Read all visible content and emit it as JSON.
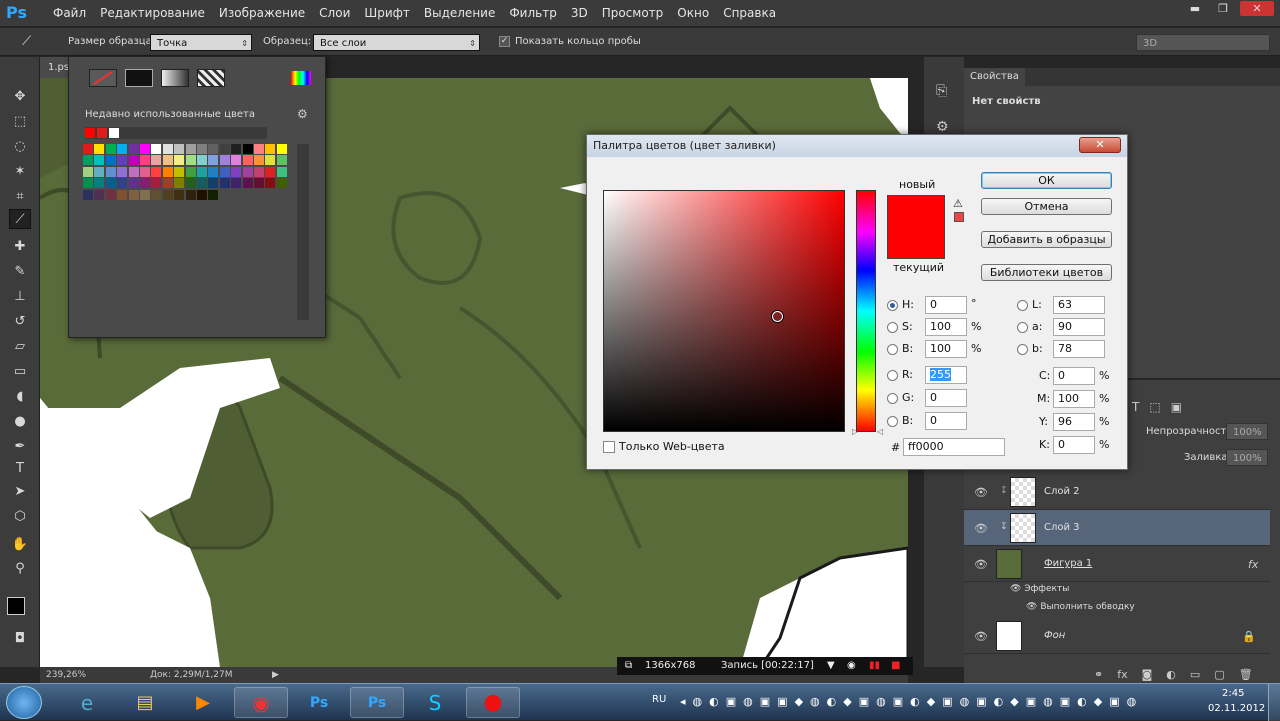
{
  "menubar": {
    "logo": "Ps",
    "items": [
      "Файл",
      "Редактирование",
      "Изображение",
      "Слои",
      "Шрифт",
      "Выделение",
      "Фильтр",
      "3D",
      "Просмотр",
      "Окно",
      "Справка"
    ],
    "minimize": "▬",
    "restore": "❐",
    "close": "✕"
  },
  "options": {
    "sample_size_label": "Размер образца:",
    "sample_size_value": "Точка",
    "sample_label": "Образец:",
    "sample_value": "Все слои",
    "show_ring": "Показать кольцо пробы",
    "workspace": "3D"
  },
  "document": {
    "tab": "1.ps",
    "zoom": "239,26%",
    "doc_info": "Док: 2,29M/1,27M"
  },
  "swatches": {
    "recent_label": "Недавно использованные цвета",
    "recent": [
      "#ff0000",
      "#e31b1b",
      "#ffffff"
    ],
    "colors": [
      "#e31b1b",
      "#ffe000",
      "#00b050",
      "#00b0f0",
      "#7030a0",
      "#ff00ff",
      "#ffffff",
      "#e0e0e0",
      "#c0c0c0",
      "#a0a0a0",
      "#808080",
      "#606060",
      "#404040",
      "#202020",
      "#000000",
      "#ff8080",
      "#ffc000",
      "#ffff00",
      "#00a060",
      "#00c0c0",
      "#0070c0",
      "#6040c0",
      "#c000c0",
      "#ff4080",
      "#f0a0a0",
      "#f0c080",
      "#f0f080",
      "#a0e080",
      "#80d0d0",
      "#80a0e0",
      "#a080e0",
      "#e080e0",
      "#ff6060",
      "#ff9040",
      "#e0e040",
      "#60c060",
      "#a0d080",
      "#60b0c0",
      "#6090d0",
      "#9070d0",
      "#c070c0",
      "#e06090",
      "#ff4040",
      "#ff8000",
      "#c0c000",
      "#40a040",
      "#20a0a0",
      "#2080c0",
      "#4060c0",
      "#8040c0",
      "#a040a0",
      "#c04070",
      "#e02020",
      "#40c080",
      "#009050",
      "#008080",
      "#006090",
      "#304090",
      "#603090",
      "#802070",
      "#a02040",
      "#a04020",
      "#808000",
      "#206020",
      "#106060",
      "#104070",
      "#203070",
      "#402070",
      "#601050",
      "#601030",
      "#801010",
      "#406000",
      "#303060",
      "#503050",
      "#703040",
      "#805030",
      "#806040",
      "#807050",
      "#605030",
      "#504020",
      "#403010",
      "#302010",
      "#201000",
      "#102000"
    ]
  },
  "dialog": {
    "title": "Палитра цветов (цвет заливки)",
    "close": "✕",
    "new_label": "новый",
    "current_label": "текущий",
    "ok": "ОК",
    "cancel": "Отмена",
    "add_to_swatches": "Добавить в образцы",
    "color_libraries": "Библиотеки цветов",
    "new_color": "#ff0000",
    "current_color": "#ff0000",
    "h_label": "H:",
    "h_value": "0",
    "h_unit": "°",
    "s_label": "S:",
    "s_value": "100",
    "s_unit": "%",
    "b_label": "B:",
    "b_value": "100",
    "b_unit": "%",
    "r_label": "R:",
    "r_value": "255",
    "g_label": "G:",
    "g_value": "0",
    "bb_label": "B:",
    "bb_value": "0",
    "l_label": "L:",
    "l_value": "63",
    "a_label": "a:",
    "a_value": "90",
    "b2_label": "b:",
    "b2_value": "78",
    "c_label": "C:",
    "c_value": "0",
    "c_unit": "%",
    "m_label": "M:",
    "m_value": "100",
    "m_unit": "%",
    "y_label": "Y:",
    "y_value": "96",
    "y_unit": "%",
    "k_label": "K:",
    "k_value": "0",
    "k_unit": "%",
    "hex_label": "#",
    "hex_value": "ff0000",
    "web_only": "Только Web-цвета"
  },
  "properties": {
    "tab": "Свойства",
    "no_props": "Нет свойств"
  },
  "layers": {
    "opacity_label": "Непрозрачность:",
    "opacity_value": "100%",
    "fill_label": "Заливка:",
    "fill_value": "100%",
    "items": [
      {
        "name": "Слой 2"
      },
      {
        "name": "Слой 3"
      },
      {
        "name": "Фигура 1",
        "fx": "fx"
      },
      {
        "name": "Эффекты"
      },
      {
        "name": "Выполнить обводку"
      },
      {
        "name": "Фон"
      }
    ]
  },
  "recording": {
    "resolution": "1366x768",
    "status": "Запись [00:22:17]"
  },
  "taskbar": {
    "lang": "RU",
    "time": "2:45",
    "date": "02.11.2012"
  }
}
